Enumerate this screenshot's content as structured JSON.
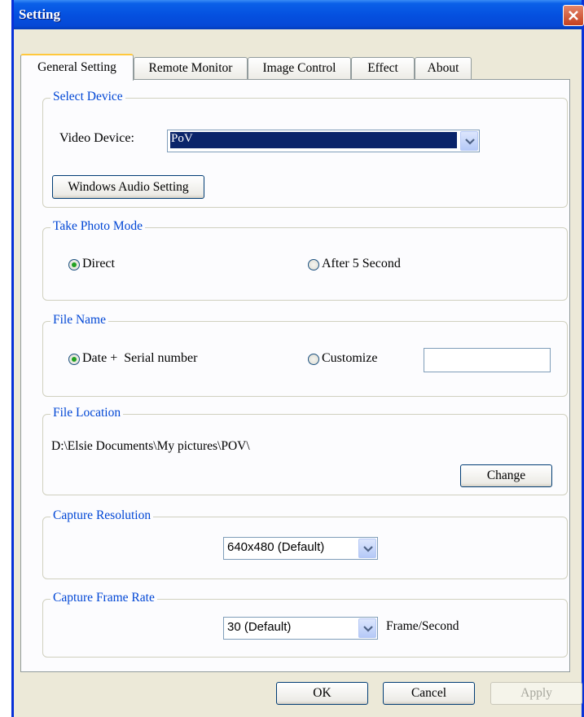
{
  "window": {
    "title": "Setting"
  },
  "tabs": [
    {
      "label": "General Setting"
    },
    {
      "label": "Remote Monitor"
    },
    {
      "label": "Image Control"
    },
    {
      "label": "Effect"
    },
    {
      "label": "About"
    }
  ],
  "select_device": {
    "legend": "Select Device",
    "video_device_label": "Video Device:",
    "video_device_value": "PoV",
    "audio_button": "Windows Audio Setting"
  },
  "photo_mode": {
    "legend": "Take Photo Mode",
    "options": [
      {
        "label": "Direct",
        "checked": true
      },
      {
        "label": "After 5 Second",
        "checked": false
      }
    ]
  },
  "file_name": {
    "legend": "File Name",
    "options": [
      {
        "label": "Date +  Serial number",
        "checked": true
      },
      {
        "label": "Customize",
        "checked": false
      }
    ],
    "custom_value": ""
  },
  "file_location": {
    "legend": "File Location",
    "path": "D:\\Elsie Documents\\My pictures\\POV\\",
    "change_button": "Change"
  },
  "capture_resolution": {
    "legend": "Capture Resolution",
    "value": "640x480 (Default)"
  },
  "capture_frame_rate": {
    "legend": "Capture Frame Rate",
    "value": "30 (Default)",
    "unit": "Frame/Second"
  },
  "footer": {
    "ok": "OK",
    "cancel": "Cancel",
    "apply": "Apply"
  },
  "colors": {
    "accent": "#0046d5",
    "titlebar": "#0551e0",
    "dialog_bg": "#ece9d8"
  },
  "icons": {
    "close": "close-icon",
    "dropdown": "chevron-down-icon"
  }
}
